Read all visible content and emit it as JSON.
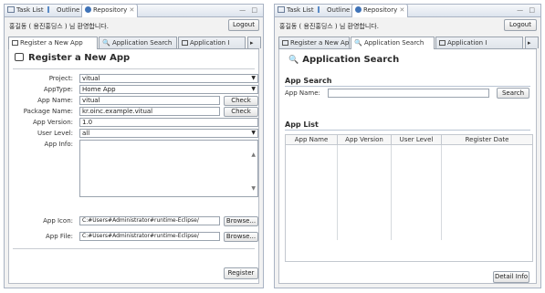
{
  "left_panel": {
    "view_tabs": [
      "Task List",
      "Outline",
      "Repository"
    ],
    "view_controls": "— □",
    "welcome": "홍길동 ( 용진홍딩스 ) 님 환영합니다.",
    "logout": "Logout",
    "editor_tabs": [
      "Register a New App",
      "Application Search",
      "Application I"
    ],
    "form_title": "Register a New App",
    "fields": {
      "project_label": "Project:",
      "project_value": "vitual",
      "app_type_label": "AppType:",
      "app_type_value": "Home App",
      "app_name_label": "App Name:",
      "app_name_value": "vitual",
      "package_label": "Package Name:",
      "package_value": "kr.oinc.example.vitual",
      "version_label": "App Version:",
      "version_value": "1.0",
      "user_level_label": "User Level:",
      "user_level_value": "all",
      "info_label": "App Info:",
      "icon_label": "App Icon:",
      "icon_value": "C:#Users#Administrator#runtime-Eclipse/",
      "file_label": "App File:",
      "file_value": "C:#Users#Administrator#runtime-Eclipse/"
    },
    "check_label": "Check",
    "browse_label": "Browse...",
    "register_label": "Register"
  },
  "right_panel": {
    "view_tabs": [
      "Task List",
      "Outline",
      "Repository"
    ],
    "view_controls": "— □",
    "welcome": "홍길동 ( 용진홍딩스 ) 님 환영합니다.",
    "logout": "Logout",
    "editor_tabs": [
      "Register a New App",
      "Application Search",
      "Application I"
    ],
    "form_title": "Application Search",
    "app_search_section": "App Search",
    "app_name_label": "App Name:",
    "search_label": "Search",
    "app_list_section": "App List",
    "columns": [
      "App Name",
      "App Version",
      "User Level",
      "Register Date"
    ],
    "detail_label": "Detail Info"
  },
  "colors": {
    "panel_border": "#a9b3c4",
    "panel_bg": "#f2f2f2",
    "content_bg": "#ffffff"
  }
}
